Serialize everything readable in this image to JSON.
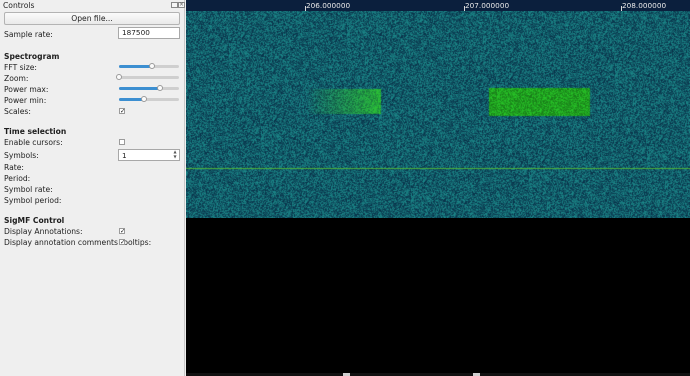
{
  "window": {
    "dock_title": "Controls"
  },
  "controls": {
    "open_file": "Open file...",
    "sample_rate_label": "Sample rate:",
    "sample_rate_value": "187500"
  },
  "spectrogram": {
    "section_title": "Spectrogram",
    "fft_size_label": "FFT size:",
    "zoom_label": "Zoom:",
    "power_max_label": "Power max:",
    "power_min_label": "Power min:",
    "scales_label": "Scales:",
    "fft_size_level": 0.55,
    "zoom_level": 0.0,
    "power_max_level": 0.68,
    "power_min_level": 0.42,
    "scales_checked": true
  },
  "time_selection": {
    "section_title": "Time selection",
    "enable_cursors_label": "Enable cursors:",
    "enable_cursors_checked": false,
    "symbols_label": "Symbols:",
    "symbols_value": "1",
    "rate_label": "Rate:",
    "period_label": "Period:",
    "symbol_rate_label": "Symbol rate:",
    "symbol_period_label": "Symbol period:"
  },
  "sigmf": {
    "section_title": "SigMF Control",
    "display_annotations_label": "Display Annotations:",
    "display_annotations_checked": true,
    "tooltips_label": "Display annotation comments tooltips:",
    "tooltips_checked": true
  },
  "frequency_axis": {
    "labels": [
      "206.000000",
      "207.000000",
      "208.000000"
    ],
    "values": [
      206.0,
      207.0,
      208.0
    ]
  },
  "colors": {
    "noise_base": "#0b3a55",
    "signal": "#3fd43a",
    "center_line": "#4caf3a"
  }
}
